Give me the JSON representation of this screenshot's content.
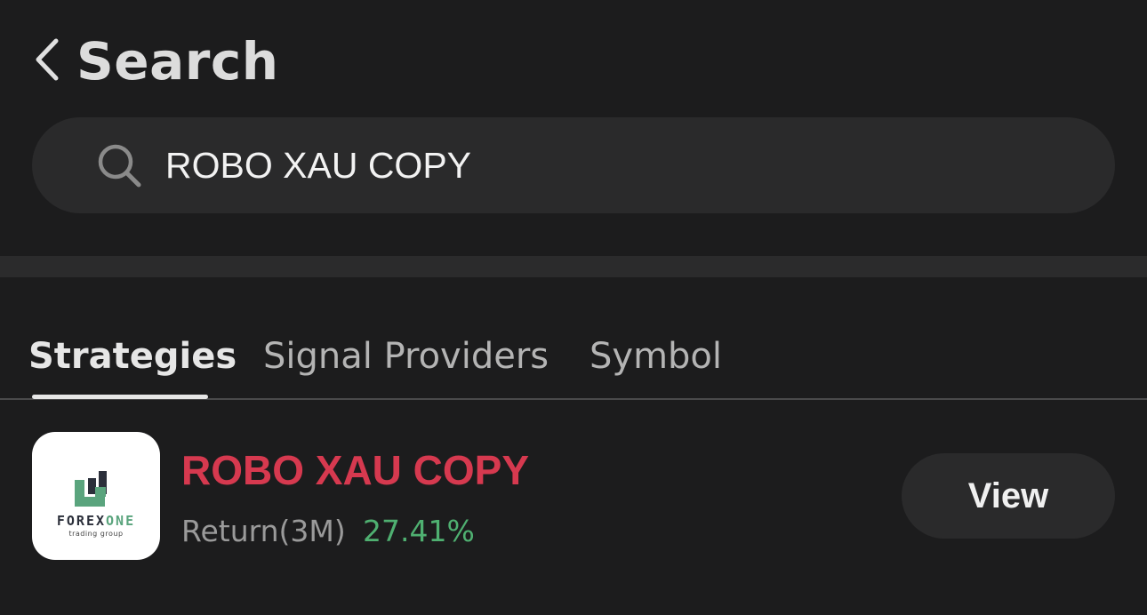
{
  "header": {
    "back_icon": "chevron-left-icon",
    "title": "Search"
  },
  "search": {
    "icon": "search-icon",
    "value": "ROBO XAU COPY"
  },
  "tabs": [
    {
      "label": "Strategies",
      "active": true
    },
    {
      "label": "Signal Providers",
      "active": false
    },
    {
      "label": "Symbol",
      "active": false
    }
  ],
  "results": [
    {
      "logo": {
        "word_dark": "FOREX",
        "word_accent": "ONE",
        "tagline": "trading group"
      },
      "name": "ROBO XAU COPY",
      "return_label": "Return(3M)",
      "return_value": "27.41%",
      "action_label": "View"
    }
  ],
  "colors": {
    "background": "#1c1c1d",
    "surface": "#2a2a2b",
    "strategy_name": "#d6394f",
    "return_positive": "#4fb071",
    "logo_accent": "#5aa47d"
  }
}
